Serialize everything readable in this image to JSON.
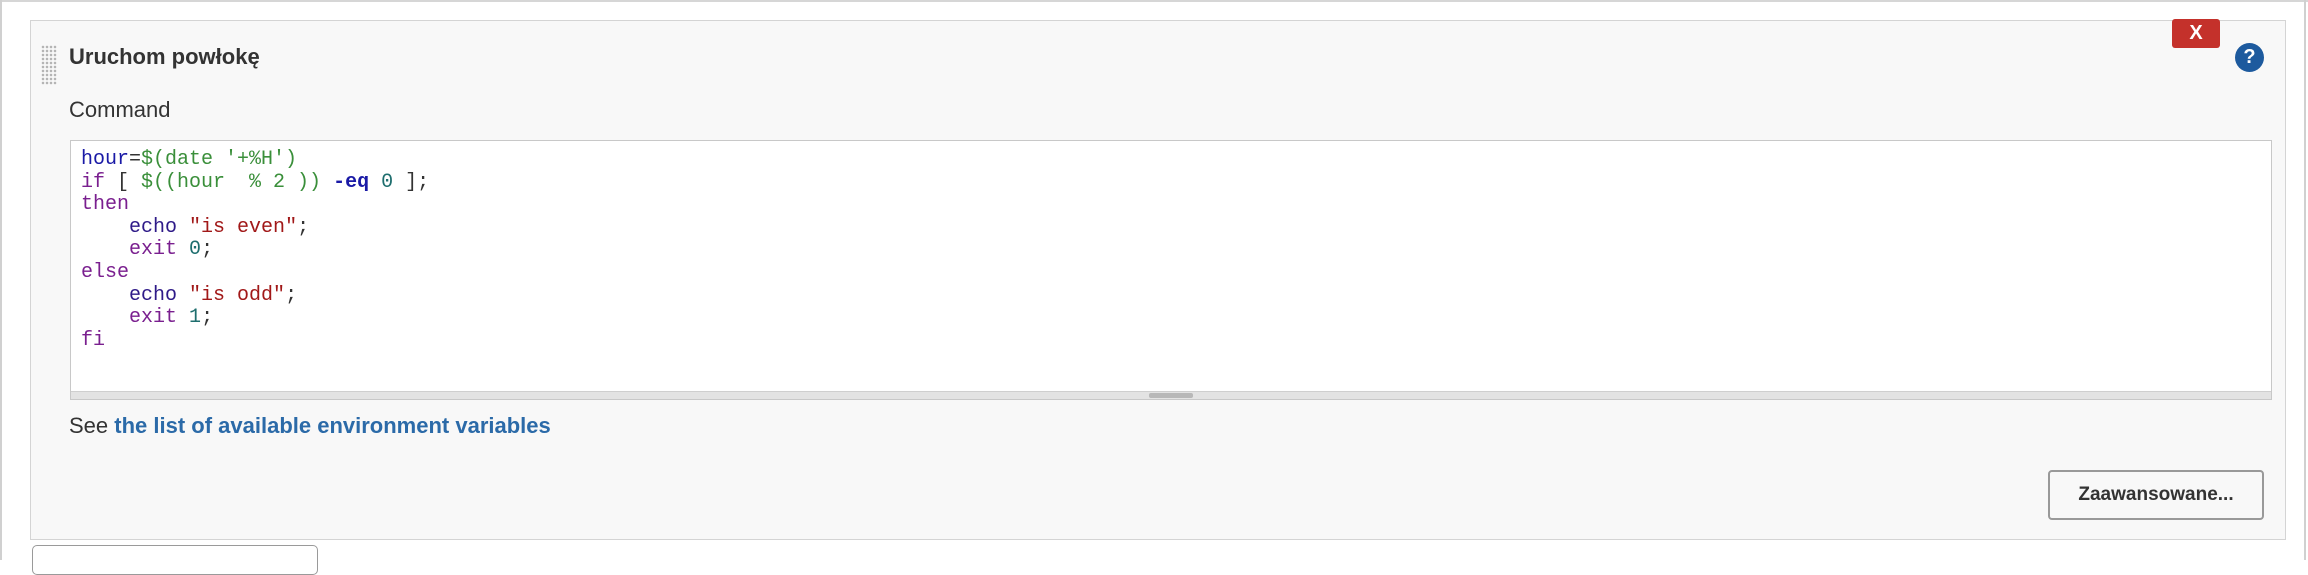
{
  "step": {
    "title": "Uruchom powłokę",
    "delete_label": "X",
    "help_label": "?"
  },
  "command": {
    "label": "Command",
    "lines": [
      "hour=$(date '+%H')",
      "if [ $((hour  % 2 )) -eq 0 ];",
      "then",
      "    echo \"is even\";",
      "    exit 0;",
      "else",
      "    echo \"is odd\";",
      "    exit 1;",
      "fi"
    ]
  },
  "env_vars": {
    "prefix": "See ",
    "link_text": "the list of available environment variables"
  },
  "advanced": {
    "label": "Zaawansowane..."
  },
  "colors": {
    "delete_button": "#c4312b",
    "help_icon": "#1d5a9e",
    "link": "#2b6aa8"
  }
}
